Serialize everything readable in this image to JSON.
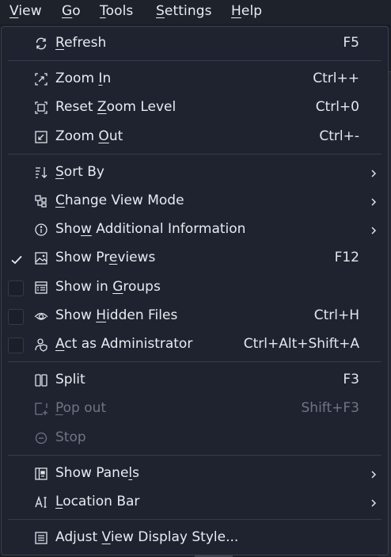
{
  "menubar": {
    "items": [
      {
        "label": "View",
        "mnemonic_index": 0
      },
      {
        "label": "Go",
        "mnemonic_index": 0
      },
      {
        "label": "Tools",
        "mnemonic_index": 0
      },
      {
        "label": "Settings",
        "mnemonic_index": 0
      },
      {
        "label": "Help",
        "mnemonic_index": 0
      }
    ]
  },
  "menu": {
    "items": [
      {
        "label": "Refresh",
        "mnemonic_index": 0,
        "shortcut": "F5",
        "icon": "refresh-icon"
      },
      {
        "label": "Zoom In",
        "mnemonic_index": 5,
        "shortcut": "Ctrl++",
        "icon": "zoom-in-icon"
      },
      {
        "label": "Reset Zoom Level",
        "mnemonic_index": 6,
        "shortcut": "Ctrl+0",
        "icon": "reset-zoom-icon"
      },
      {
        "label": "Zoom Out",
        "mnemonic_index": 5,
        "shortcut": "Ctrl+-",
        "icon": "zoom-out-icon"
      },
      {
        "label": "Sort By",
        "mnemonic_index": 0,
        "submenu": true,
        "icon": "sort-icon"
      },
      {
        "label": "Change View Mode",
        "mnemonic_index": 0,
        "submenu": true,
        "icon": "view-mode-icon"
      },
      {
        "label": "Show Additional Information",
        "mnemonic_index": 3,
        "submenu": true,
        "icon": "info-icon"
      },
      {
        "label": "Show Previews",
        "mnemonic_index": 7,
        "shortcut": "F12",
        "icon": "image-icon",
        "checkable": true,
        "checked": true
      },
      {
        "label": "Show in Groups",
        "mnemonic_index": 8,
        "icon": "groups-icon",
        "checkable": true,
        "checked": false
      },
      {
        "label": "Show Hidden Files",
        "mnemonic_index": 5,
        "shortcut": "Ctrl+H",
        "icon": "eye-icon",
        "checkable": true,
        "checked": false
      },
      {
        "label": "Act as Administrator",
        "mnemonic_index": 0,
        "shortcut": "Ctrl+Alt+Shift+A",
        "icon": "admin-icon",
        "checkable": true,
        "checked": false
      },
      {
        "label": "Split",
        "mnemonic_index": -1,
        "shortcut": "F3",
        "icon": "split-icon"
      },
      {
        "label": "Pop out",
        "mnemonic_index": 0,
        "shortcut": "Shift+F3",
        "icon": "pop-out-icon",
        "disabled": true
      },
      {
        "label": "Stop",
        "mnemonic_index": -1,
        "icon": "stop-icon",
        "disabled": true
      },
      {
        "label": "Show Panels",
        "mnemonic_index": 9,
        "submenu": true,
        "icon": "panels-icon"
      },
      {
        "label": "Location Bar",
        "mnemonic_index": 0,
        "submenu": true,
        "icon": "location-bar-icon"
      },
      {
        "label": "Adjust View Display Style...",
        "mnemonic_index": 7,
        "icon": "display-style-icon"
      }
    ]
  },
  "colors": {
    "menu_background": "#1f2330",
    "text": "#e8ebf1",
    "disabled_text": "#6f7582",
    "separator": "#363c4a"
  }
}
